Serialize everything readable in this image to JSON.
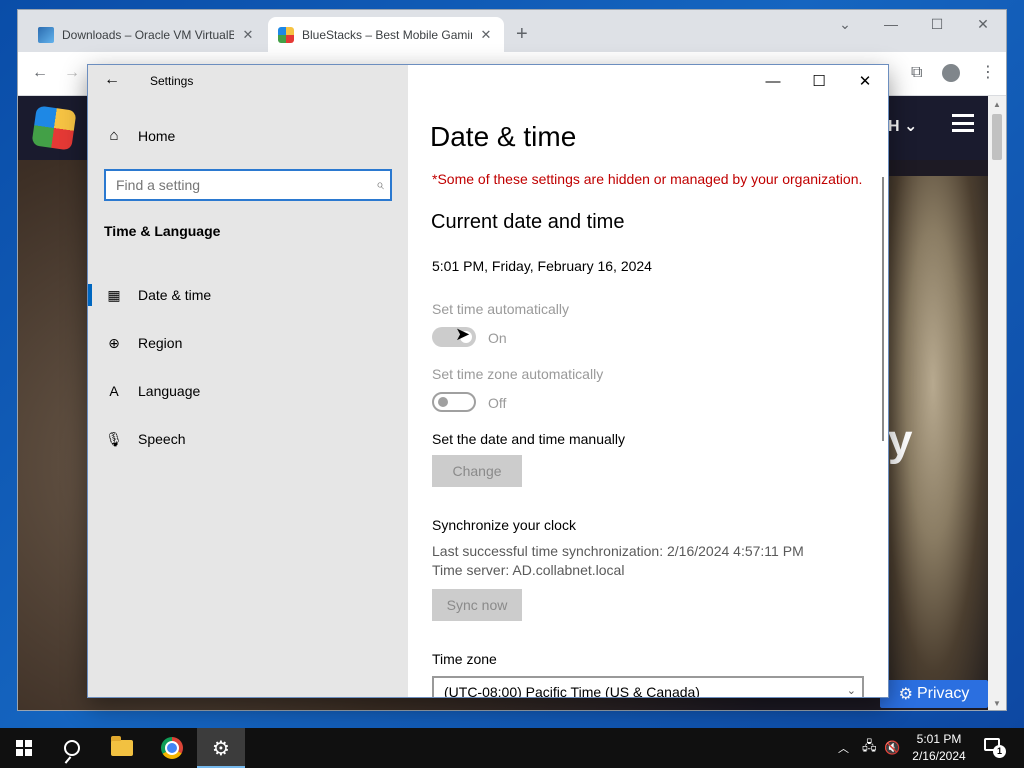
{
  "browser": {
    "tabs": [
      {
        "title": "Downloads – Oracle VM VirtualB"
      },
      {
        "title": "BlueStacks – Best Mobile Gaming"
      }
    ],
    "page": {
      "language_code": "H",
      "privacy_label": "Privacy",
      "hero_fragment": "y"
    }
  },
  "settings": {
    "app_title": "Settings",
    "home_label": "Home",
    "search_placeholder": "Find a setting",
    "section_title": "Time & Language",
    "nav": [
      {
        "label": "Date & time",
        "icon": "date-time-icon",
        "active": true
      },
      {
        "label": "Region",
        "icon": "region-icon",
        "active": false
      },
      {
        "label": "Language",
        "icon": "language-icon",
        "active": false
      },
      {
        "label": "Speech",
        "icon": "microphone-icon",
        "active": false
      }
    ],
    "page_title": "Date & time",
    "managed_notice": "*Some of these settings are hidden or managed by your organization.",
    "current_heading": "Current date and time",
    "current_datetime": "5:01 PM, Friday, February 16, 2024",
    "set_time_auto": {
      "label": "Set time automatically",
      "state": "On",
      "enabled": false
    },
    "set_tz_auto": {
      "label": "Set time zone automatically",
      "state": "Off",
      "enabled": false
    },
    "manual": {
      "label": "Set the date and time manually",
      "button": "Change"
    },
    "sync": {
      "heading": "Synchronize your clock",
      "last_sync": "Last successful time synchronization: 2/16/2024 4:57:11 PM",
      "server": "Time server: AD.collabnet.local",
      "button": "Sync now"
    },
    "timezone": {
      "label": "Time zone",
      "value": "(UTC-08:00) Pacific Time (US & Canada)"
    }
  },
  "taskbar": {
    "time": "5:01 PM",
    "date": "2/16/2024",
    "notification_count": "1"
  },
  "colors": {
    "accent": "#0067c0",
    "managed_text": "#c00000",
    "search_border": "#2b79d0"
  }
}
